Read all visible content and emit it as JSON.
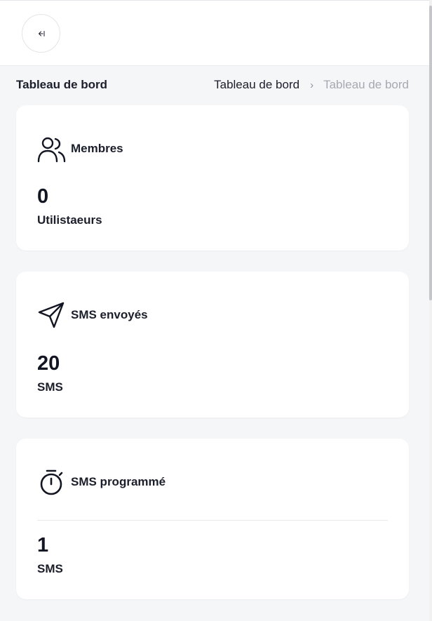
{
  "page": {
    "title": "Tableau de bord",
    "breadcrumb": {
      "link": "Tableau de bord",
      "separator": "›",
      "current": "Tableau de bord"
    }
  },
  "topbar": {
    "collapse_icon": "collapse-sidebar-icon"
  },
  "cards": [
    {
      "icon": "users-icon",
      "label": "Membres",
      "value": "0",
      "unit": "Utilistaeurs"
    },
    {
      "icon": "send-icon",
      "label": "SMS envoyés",
      "value": "20",
      "unit": "SMS"
    },
    {
      "icon": "stopwatch-icon",
      "label": "SMS programmé",
      "value": "1",
      "unit": "SMS"
    }
  ],
  "colors": {
    "background": "#f5f6f8",
    "card": "#ffffff",
    "text": "#1b1e2b",
    "muted": "#a5a9b1"
  }
}
